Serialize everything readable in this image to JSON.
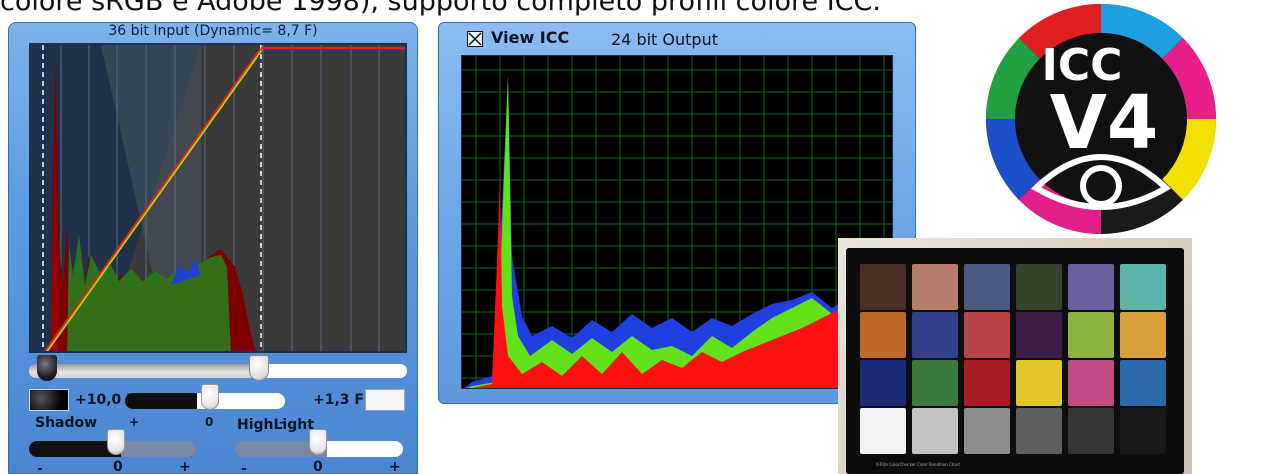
{
  "caption": "colore sRGB e Adobe 1998), supporto completo profili colore ICC.",
  "left_panel": {
    "title": "36 bit Input (Dynamic= 8,7 F)",
    "black_point_value": "+10,0 F",
    "white_point_value": "+1,3 F",
    "top_slider_marks": {
      "minus": "+",
      "zero": "0",
      "plus": "-"
    },
    "shadow": {
      "label": "Shadow",
      "minus": "-",
      "zero": "0",
      "plus": "+",
      "level": 0.45
    },
    "highlight": {
      "label": "HighLight",
      "minus": "-",
      "zero": "0",
      "plus": "+",
      "level": 0.45
    }
  },
  "mid_panel": {
    "checkbox_checked": true,
    "view_label": "View ICC",
    "output_label": "24 bit Output"
  },
  "logo": {
    "line1": "ICC",
    "line2": "V4"
  },
  "checker": {
    "footer": "X-Rite ColorChecker Color Rendition Chart",
    "patches": [
      "#4a2f28",
      "#b67e6b",
      "#4a5a80",
      "#35442a",
      "#6a62a0",
      "#5ab2a8",
      "#c06a28",
      "#33408c",
      "#b84448",
      "#3e1d44",
      "#8fb23f",
      "#d8a23a",
      "#1e2c78",
      "#3a7a3c",
      "#a61e24",
      "#e0c628",
      "#c04c84",
      "#2a6aa8",
      "#f2f2f0",
      "#c2c2c2",
      "#8e8e8e",
      "#5e5e5e",
      "#363636",
      "#181818"
    ]
  },
  "colors": {
    "panel_blue": "#5e9be0",
    "curve_red": "#e81f1f",
    "hist_green": "#62e21a",
    "hist_blue": "#1f3fe0",
    "hist_dark_red": "#7c0000"
  }
}
